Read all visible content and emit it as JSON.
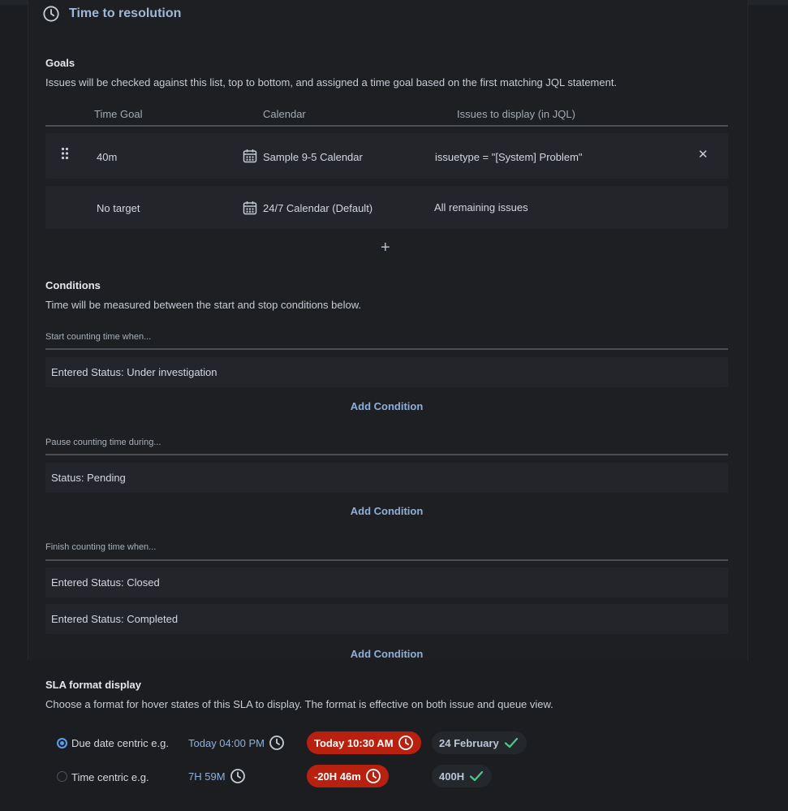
{
  "header": {
    "title": "Time to resolution",
    "icon": "clock-icon"
  },
  "goals": {
    "title": "Goals",
    "description": "Issues will be checked against this list, top to bottom, and assigned a time goal based on the first matching JQL statement.",
    "columns": [
      "Time Goal",
      "Calendar",
      "Issues to display (in JQL)"
    ],
    "rows": [
      {
        "time_goal": "40m",
        "calendar": "Sample 9-5 Calendar",
        "jql": "issuetype = \"[System] Problem\""
      },
      {
        "time_goal": "No target",
        "calendar": "24/7 Calendar (Default)",
        "jql": "All remaining issues"
      }
    ],
    "add_goal": "+"
  },
  "conditions": {
    "title": "Conditions",
    "description": "Time will be measured between the start and stop conditions below.",
    "start": {
      "label": "Start counting time when...",
      "items": [
        "Entered Status: Under investigation"
      ],
      "add_label": "Add Condition"
    },
    "pause": {
      "label": "Pause counting time during...",
      "items": [
        "Status: Pending"
      ],
      "add_label": "Add Condition"
    },
    "finish": {
      "label": "Finish counting time when...",
      "items": [
        "Entered Status: Closed",
        "Entered Status: Completed"
      ],
      "add_label": "Add Condition"
    }
  },
  "sla_format": {
    "title": "SLA format display",
    "description": "Choose a format for hover states of this SLA to display. The format is effective on both issue and queue view.",
    "options": [
      {
        "label": "Due date centric e.g.",
        "selected": true,
        "example_ok": "Today 04:00 PM",
        "example_breached": "Today 10:30 AM",
        "example_done": "24 February"
      },
      {
        "label": "Time centric e.g.",
        "selected": false,
        "example_ok": "7H 59M",
        "example_breached": "-20H 46m",
        "example_done": "400H"
      }
    ]
  },
  "colors": {
    "accent": "#8fb0da",
    "breached": "#b8210f",
    "success": "#4cc98a"
  }
}
